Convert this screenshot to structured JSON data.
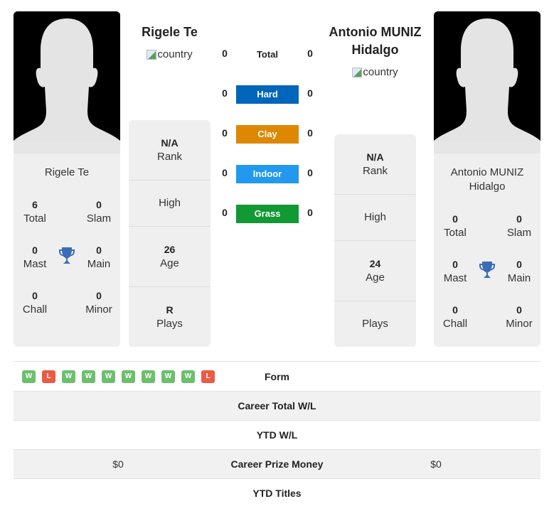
{
  "player1": {
    "name": "Rigele Te",
    "country_alt": "country",
    "card_name": "Rigele Te",
    "titles": {
      "total": {
        "value": "6",
        "label": "Total"
      },
      "slam": {
        "value": "0",
        "label": "Slam"
      },
      "mast": {
        "value": "0",
        "label": "Mast"
      },
      "main": {
        "value": "0",
        "label": "Main"
      },
      "chall": {
        "value": "0",
        "label": "Chall"
      },
      "minor": {
        "value": "0",
        "label": "Minor"
      }
    },
    "stats": {
      "rank": {
        "value": "N/A",
        "label": "Rank"
      },
      "high": {
        "value": "",
        "label": "High"
      },
      "age": {
        "value": "26",
        "label": "Age"
      },
      "plays": {
        "value": "R",
        "label": "Plays"
      }
    }
  },
  "player2": {
    "name_line1": "Antonio MUNIZ",
    "name_line2": "Hidalgo",
    "country_alt": "country",
    "card_name_line1": "Antonio MUNIZ",
    "card_name_line2": "Hidalgo",
    "titles": {
      "total": {
        "value": "0",
        "label": "Total"
      },
      "slam": {
        "value": "0",
        "label": "Slam"
      },
      "mast": {
        "value": "0",
        "label": "Mast"
      },
      "main": {
        "value": "0",
        "label": "Main"
      },
      "chall": {
        "value": "0",
        "label": "Chall"
      },
      "minor": {
        "value": "0",
        "label": "Minor"
      }
    },
    "stats": {
      "rank": {
        "value": "N/A",
        "label": "Rank"
      },
      "high": {
        "value": "",
        "label": "High"
      },
      "age": {
        "value": "24",
        "label": "Age"
      },
      "plays": {
        "value": "",
        "label": "Plays"
      }
    }
  },
  "h2h": {
    "total": {
      "label": "Total",
      "p1": "0",
      "p2": "0"
    },
    "surfaces": [
      {
        "label": "Hard",
        "p1": "0",
        "p2": "0",
        "color": "#0066bb"
      },
      {
        "label": "Clay",
        "p1": "0",
        "p2": "0",
        "color": "#dd8800"
      },
      {
        "label": "Indoor",
        "p1": "0",
        "p2": "0",
        "color": "#2299ee"
      },
      {
        "label": "Grass",
        "p1": "0",
        "p2": "0",
        "color": "#119933"
      }
    ]
  },
  "form": {
    "label": "Form",
    "results": [
      "W",
      "L",
      "W",
      "W",
      "W",
      "W",
      "W",
      "W",
      "W",
      "L"
    ]
  },
  "table": [
    {
      "label": "Career Total W/L",
      "p1": "",
      "p2": ""
    },
    {
      "label": "YTD W/L",
      "p1": "",
      "p2": ""
    },
    {
      "label": "Career Prize Money",
      "p1": "$0",
      "p2": "$0"
    },
    {
      "label": "YTD Titles",
      "p1": "",
      "p2": ""
    }
  ],
  "colors": {
    "win": "#6cbf6c",
    "loss": "#ea5a45",
    "trophy": "#3a6db5",
    "card_bg": "#efefef"
  }
}
